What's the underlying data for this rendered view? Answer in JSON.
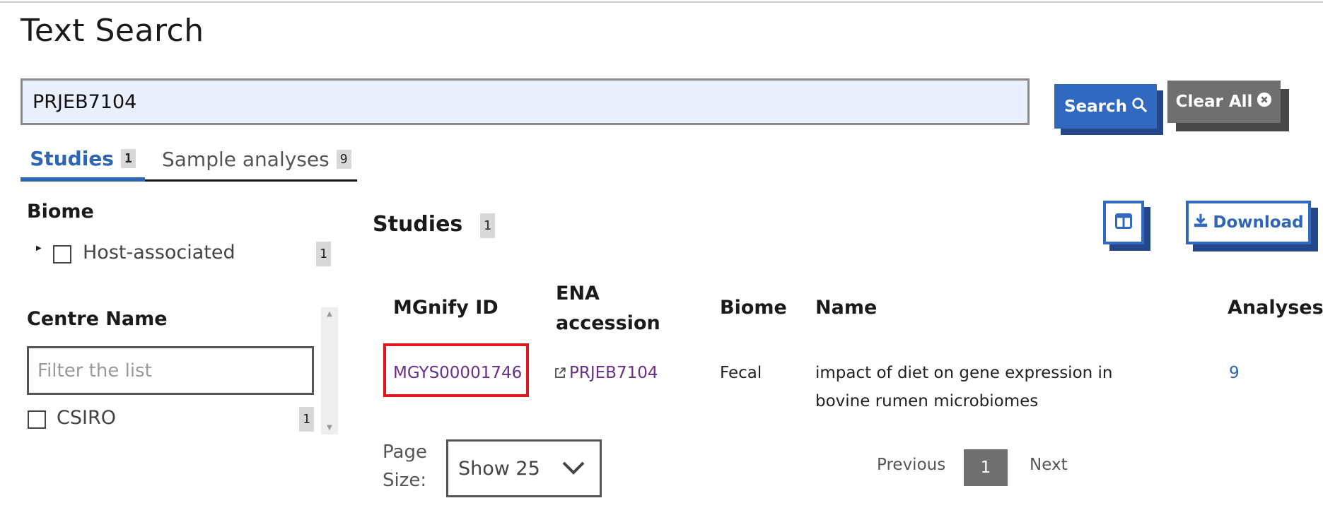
{
  "page": {
    "title": "Text Search"
  },
  "search": {
    "value": "PRJEB7104",
    "button_label": "Search",
    "clear_label": "Clear All"
  },
  "tabs": [
    {
      "label": "Studies",
      "count": "1"
    },
    {
      "label": "Sample analyses",
      "count": "9"
    }
  ],
  "facets": {
    "biome": {
      "title": "Biome",
      "items": [
        {
          "label": "Host-associated",
          "count": "1"
        }
      ]
    },
    "centre": {
      "title": "Centre Name",
      "filter_placeholder": "Filter the list",
      "items": [
        {
          "label": "CSIRO",
          "count": "1"
        }
      ]
    }
  },
  "results": {
    "title": "Studies",
    "count": "1",
    "download_label": "Download",
    "columns": [
      "MGnify ID",
      "ENA accession",
      "Biome",
      "Name",
      "Analyses"
    ],
    "rows": [
      {
        "mgnify_id": "MGYS00001746",
        "ena_accession": "PRJEB7104",
        "biome": "Fecal",
        "name": "impact of diet on gene expression in bovine rumen microbiomes",
        "analyses": "9"
      }
    ]
  },
  "pagination": {
    "page_size_label": "Page Size:",
    "page_size_value": "Show 25",
    "prev_label": "Previous",
    "current_page": "1",
    "next_label": "Next"
  },
  "colors": {
    "primary": "#3169c0",
    "primary_shadow": "#24478b",
    "link_visited": "#6b2f8a",
    "highlight": "#e0161e",
    "search_bg": "#e9f0fb"
  }
}
